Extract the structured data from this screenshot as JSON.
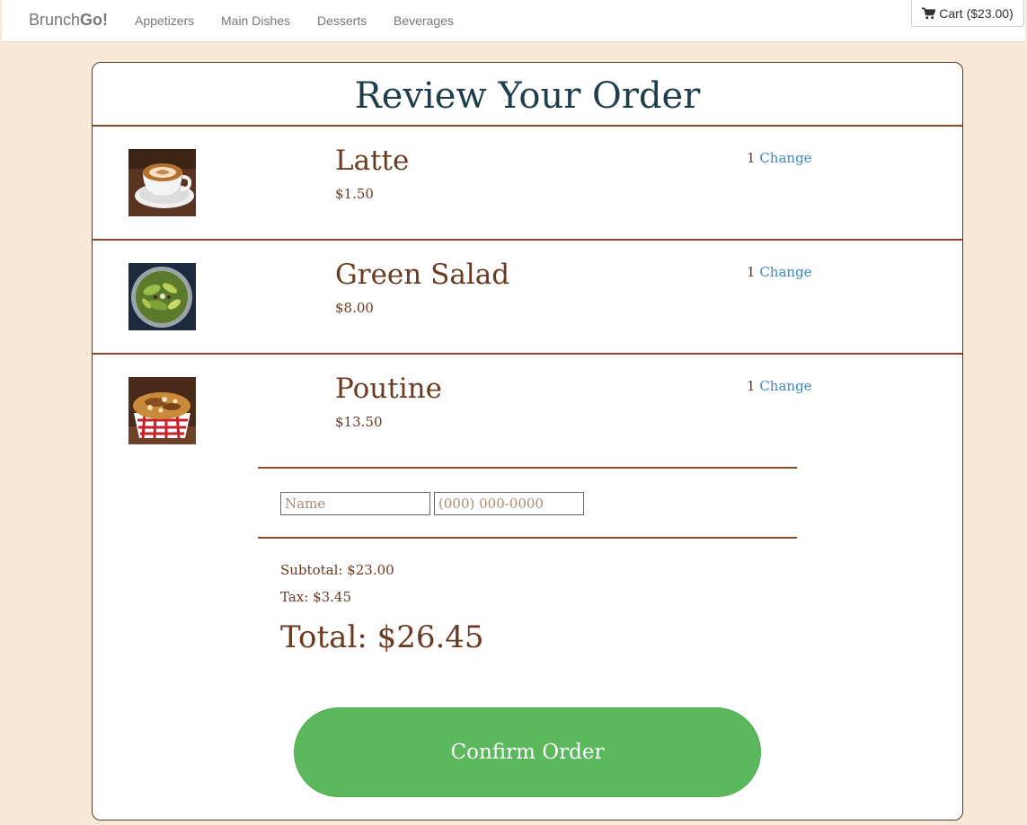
{
  "navbar": {
    "brand_prefix": "Brunch",
    "brand_suffix": "Go!",
    "links": [
      "Appetizers",
      "Main Dishes",
      "Desserts",
      "Beverages"
    ],
    "cart_label": "Cart ($23.00)"
  },
  "order": {
    "title": "Review Your Order",
    "change_label": "Change",
    "items": [
      {
        "name": "Latte",
        "price": "$1.50",
        "qty": "1",
        "image": "latte-photo"
      },
      {
        "name": "Green Salad",
        "price": "$8.00",
        "qty": "1",
        "image": "green-salad-photo"
      },
      {
        "name": "Poutine",
        "price": "$13.50",
        "qty": "1",
        "image": "poutine-photo"
      }
    ],
    "name_placeholder": "Name",
    "phone_placeholder": "(000) 000-0000",
    "subtotal": "Subtotal: $23.00",
    "tax": "Tax: $3.45",
    "total": "Total: $26.45",
    "confirm_label": "Confirm Order"
  },
  "colors": {
    "page_background": "#f7e8d7",
    "title": "#1e3e4c",
    "text_brown": "#6b3a20",
    "divider": "#8a4b2a",
    "link": "#3c86c4",
    "confirm_button": "#5cb85c"
  }
}
